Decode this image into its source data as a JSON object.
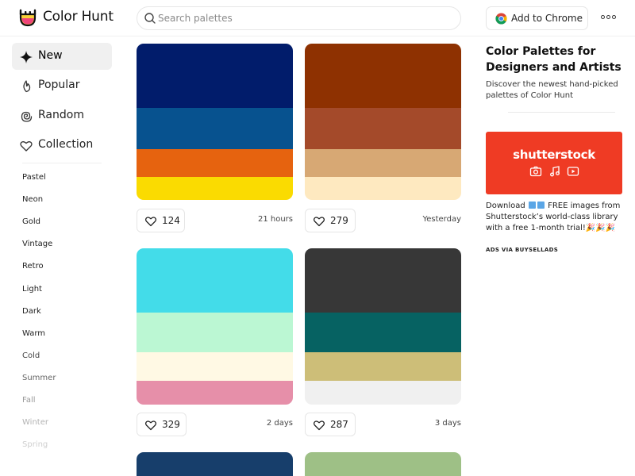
{
  "header": {
    "brand": "Color Hunt",
    "search_placeholder": "Search palettes",
    "chrome_button": "Add to Chrome"
  },
  "sidebar": {
    "nav": [
      {
        "label": "New",
        "icon": "sparkle-icon",
        "active": true
      },
      {
        "label": "Popular",
        "icon": "flame-icon",
        "active": false
      },
      {
        "label": "Random",
        "icon": "spiral-icon",
        "active": false
      },
      {
        "label": "Collection",
        "icon": "heart-icon",
        "active": false
      }
    ],
    "tags": [
      "Pastel",
      "Neon",
      "Gold",
      "Vintage",
      "Retro",
      "Light",
      "Dark",
      "Warm",
      "Cold",
      "Summer",
      "Fall",
      "Winter",
      "Spring"
    ]
  },
  "palettes": [
    {
      "colors": [
        "#011C6B",
        "#07528F",
        "#E6630F",
        "#FADB01"
      ],
      "likes": "124",
      "time": "21 hours"
    },
    {
      "colors": [
        "#8E3101",
        "#A44A2A",
        "#D7A874",
        "#FEE9C0"
      ],
      "likes": "279",
      "time": "Yesterday"
    },
    {
      "colors": [
        "#43DCE9",
        "#BBF7D3",
        "#FFF9E4",
        "#E68FA9"
      ],
      "likes": "329",
      "time": "2 days"
    },
    {
      "colors": [
        "#373737",
        "#066262",
        "#CDBE78",
        "#F0F0F0"
      ],
      "likes": "287",
      "time": "3 days"
    },
    {
      "colors": [
        "#173E6B"
      ],
      "likes": "",
      "time": ""
    },
    {
      "colors": [
        "#9EC086"
      ],
      "likes": "",
      "time": ""
    }
  ],
  "right": {
    "title": "Color Palettes for Designers and Artists",
    "subtitle": "Discover the newest hand-picked palettes of Color Hunt",
    "ad_logo": "shutterstock",
    "ad_text_before": "Download",
    "ad_text_after": "FREE images from Shutterstock’s world-class library with a free 1-month trial!🎉🎉🎉",
    "ad_via": "ADS VIA BUYSELLADS"
  },
  "colors": {
    "accent_ad": "#EF3B24",
    "logo_yellow": "#F7D038",
    "logo_pink": "#F0457A"
  }
}
